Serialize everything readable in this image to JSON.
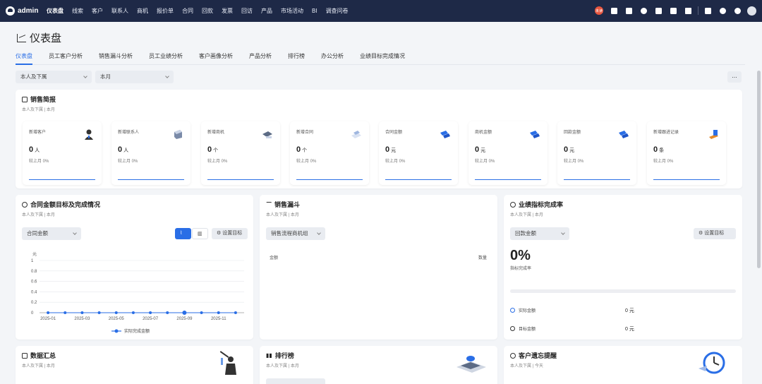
{
  "app": {
    "name": "admin"
  },
  "nav": [
    "仪表盘",
    "线索",
    "客户",
    "联系人",
    "商机",
    "报价单",
    "合同",
    "回款",
    "发票",
    "回访",
    "产品",
    "市场活动",
    "BI",
    "调查问卷"
  ],
  "top_badge": "未读",
  "page": {
    "title": "仪表盘"
  },
  "tabs": [
    "仪表盘",
    "员工客户分析",
    "销售漏斗分析",
    "员工业绩分析",
    "客户画像分析",
    "产品分析",
    "排行榜",
    "办公分析",
    "业绩目标完成情况"
  ],
  "filters": {
    "scope": "本人及下属",
    "period": "本月",
    "more": "..."
  },
  "sales_report": {
    "title": "销售简报",
    "sub": "本人及下属 | 本月",
    "stats": [
      {
        "label": "新增客户",
        "value": "0",
        "unit": "人",
        "compare": "较上月  0%",
        "icon": "user-icon"
      },
      {
        "label": "新增联系人",
        "value": "0",
        "unit": "人",
        "compare": "较上月  0%",
        "icon": "contact-icon"
      },
      {
        "label": "新增商机",
        "value": "0",
        "unit": "个",
        "compare": "较上月  0%",
        "icon": "opportunity-icon"
      },
      {
        "label": "新增合同",
        "value": "0",
        "unit": "个",
        "compare": "较上月  0%",
        "icon": "contract-icon"
      },
      {
        "label": "合同金额",
        "value": "0",
        "unit": "元",
        "compare": "较上月  0%",
        "icon": "money-icon"
      },
      {
        "label": "商机金额",
        "value": "0",
        "unit": "元",
        "compare": "较上月  0%",
        "icon": "money-icon"
      },
      {
        "label": "回款金额",
        "value": "0",
        "unit": "元",
        "compare": "较上月  0%",
        "icon": "money-icon"
      },
      {
        "label": "新增跟进记录",
        "value": "0",
        "unit": "条",
        "compare": "较上月  0%",
        "icon": "followup-icon"
      }
    ]
  },
  "contract_goal": {
    "title": "合同金额目标及完成情况",
    "sub": "本人及下属 | 本月",
    "select": "合同金额",
    "set_goal": "设置目标"
  },
  "funnel": {
    "title": "销售漏斗",
    "sub": "本人及下属 | 本月",
    "select": "销售流程商机组",
    "col_amount": "金额",
    "col_count": "数量"
  },
  "kpi": {
    "title": "业绩指标完成率",
    "sub": "本人及下属 | 本月",
    "select": "回款金额",
    "set_goal": "设置目标",
    "percent": "0%",
    "percent_label": "指标完成率",
    "progress": 0,
    "actual_label": "实际金额",
    "actual_value": "0 元",
    "target_label": "目标金额",
    "target_value": "0 元"
  },
  "data_summary": {
    "title": "数据汇总",
    "sub": "本人及下属 | 本月"
  },
  "ranking": {
    "title": "排行榜",
    "sub": "本人及下属 | 本月"
  },
  "reminder": {
    "title": "客户遗忘提醒",
    "sub": "本人及下属 | 今天"
  },
  "chart_data": {
    "type": "line",
    "ylabel": "元",
    "ylim": [
      0,
      1
    ],
    "yticks": [
      "0",
      "0.2",
      "0.4",
      "0.6",
      "0.8",
      "1"
    ],
    "x": [
      "2025-01",
      "2025-02",
      "2025-03",
      "2025-04",
      "2025-05",
      "2025-06",
      "2025-07",
      "2025-08",
      "2025-09",
      "2025-10",
      "2025-11",
      "2025-12"
    ],
    "xtick_labels": [
      "2025-01",
      "2025-03",
      "2025-05",
      "2025-07",
      "2025-09",
      "2025-11"
    ],
    "series": [
      {
        "name": "实际完成金额",
        "values": [
          0,
          0,
          0,
          0,
          0,
          0,
          0,
          0,
          0,
          0,
          0,
          0
        ]
      }
    ],
    "grid": true,
    "legend": "bottom",
    "color": "#2a6ee6"
  }
}
